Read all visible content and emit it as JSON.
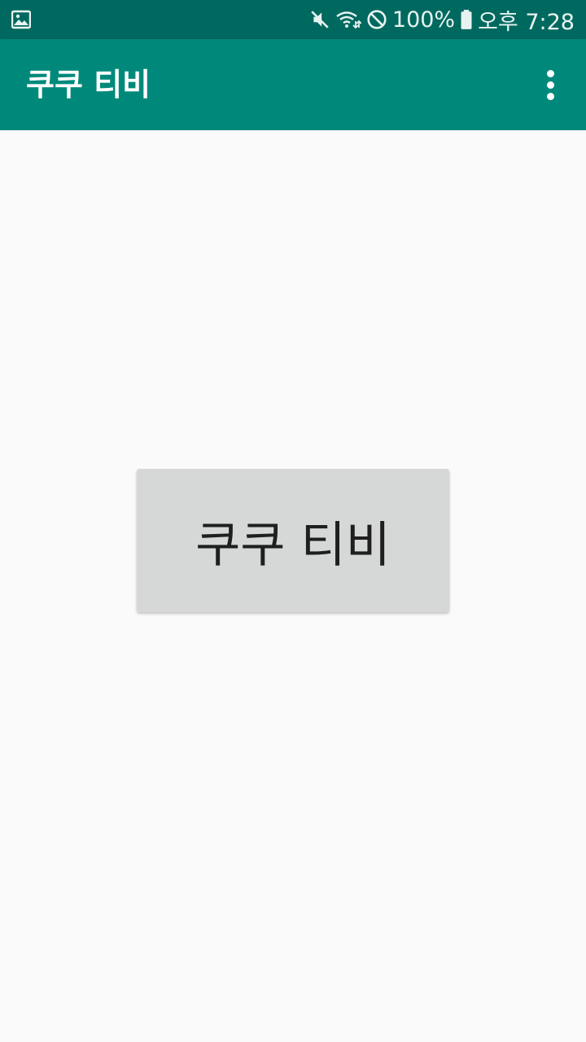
{
  "status_bar": {
    "left_icon": "gallery-icon",
    "icons": [
      "mute-icon",
      "wifi-icon",
      "block-icon"
    ],
    "battery_percent": "100%",
    "battery_icon": "battery-icon",
    "time": "오후 7:28"
  },
  "app_bar": {
    "title": "쿠쿠 티비",
    "menu_icon": "overflow-menu-icon"
  },
  "main": {
    "button_label": "쿠쿠 티비"
  },
  "colors": {
    "status_bar": "#00695f",
    "app_bar": "#00897b",
    "background": "#fafafa",
    "button": "#d6d7d7"
  }
}
